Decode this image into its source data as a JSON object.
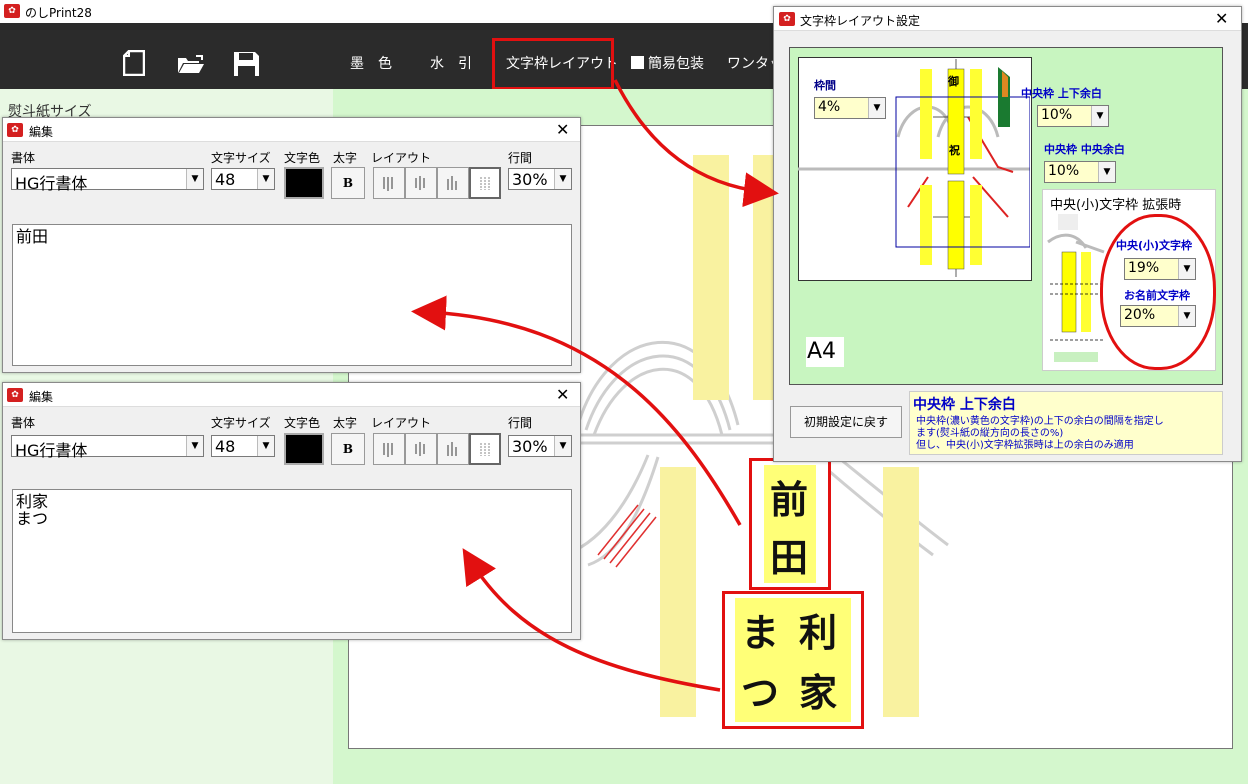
{
  "app": {
    "title": "のしPrint28",
    "icon_name": "noshi-app-icon"
  },
  "toolbar": {
    "icons": [
      "new-file-icon",
      "open-folder-icon",
      "save-disk-icon"
    ],
    "menu": [
      "墨　色",
      "水　引",
      "文字枠レイアウト",
      "簡易包装",
      "ワンタッ"
    ]
  },
  "left_panel": {
    "label": "熨斗紙サイズ"
  },
  "edit1": {
    "title": "編集",
    "font_label": "書体",
    "font_value": "HG行書体",
    "size_label": "文字サイズ",
    "size_value": "48",
    "color_label": "文字色",
    "bold_label": "太字",
    "bold_btn": "B",
    "layout_label": "レイアウト",
    "spacing_label": "行間",
    "spacing_value": "30%",
    "text_lines": [
      "前田"
    ]
  },
  "edit2": {
    "title": "編集",
    "font_label": "書体",
    "font_value": "HG行書体",
    "size_label": "文字サイズ",
    "size_value": "48",
    "color_label": "文字色",
    "bold_label": "太字",
    "bold_btn": "B",
    "layout_label": "レイアウト",
    "spacing_label": "行間",
    "spacing_value": "30%",
    "text_lines": [
      "利家",
      "まつ"
    ]
  },
  "layout_dialog": {
    "title": "文字枠レイアウト設定",
    "frame_gap_label": "枠間",
    "frame_gap_value": "4%",
    "center_margin_label": "中央枠 上下余白",
    "center_margin_value": "10%",
    "center_side_label": "中央枠 中央余白",
    "center_side_value": "10%",
    "expand_title": "中央(小)文字枠 拡張時",
    "small_frame_label": "中央(小)文字枠",
    "small_frame_value": "19%",
    "name_frame_label": "お名前文字枠",
    "name_frame_value": "20%",
    "paper_size": "A4",
    "diagram_chars": [
      "御",
      "祝"
    ],
    "reset_button": "初期設定に戻す",
    "help_title": "中央枠 上下余白",
    "help_text": [
      "中央枠(濃い黄色の文字枠)の上下の余白の間隔を指定し",
      "ます(熨斗紙の縦方向の長さの%)",
      "但し、中央(小)文字枠拡張時は上の余白のみ適用"
    ]
  },
  "preview": {
    "name1": [
      "前",
      "田"
    ],
    "name2_right": [
      "利",
      "家"
    ],
    "name2_left": [
      "ま",
      "つ"
    ]
  },
  "colors": {
    "toolbar_bg": "#2b2b2b",
    "annotation_red": "#e21010",
    "frame_yellow": "#ffff66",
    "preview_bg": "#d4f7cd"
  }
}
